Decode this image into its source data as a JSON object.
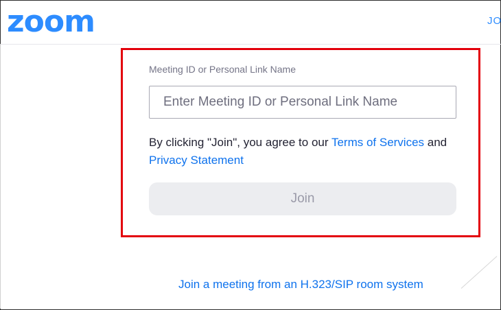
{
  "header": {
    "logo_text": "zoom",
    "nav_link": "JO"
  },
  "form": {
    "field_label": "Meeting ID or Personal Link Name",
    "input_placeholder": "Enter Meeting ID or Personal Link Name",
    "input_value": "",
    "agree_prefix": "By clicking \"Join\", you agree to our ",
    "terms_link": "Terms of Services",
    "agree_middle": " and ",
    "privacy_link": "Privacy Statement",
    "join_label": "Join"
  },
  "footer": {
    "sip_link": "Join a meeting from an H.323/SIP room system"
  },
  "colors": {
    "brand": "#2d8cff",
    "link": "#0e72ed",
    "highlight": "#e3000b",
    "disabled_button": "#ecedf0"
  }
}
